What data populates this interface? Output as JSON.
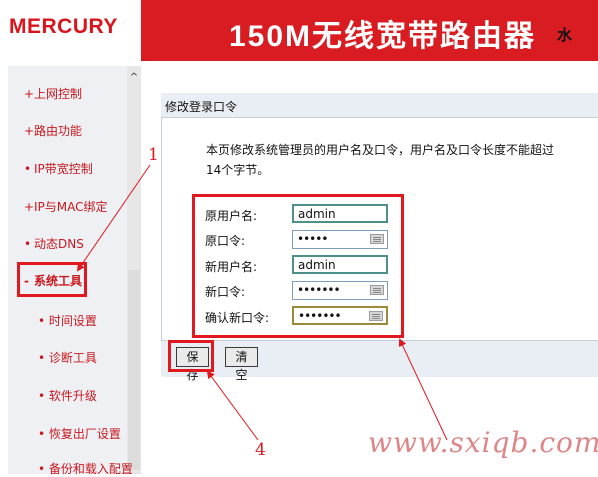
{
  "header": {
    "logo": "MERCURY",
    "title": "150M无线宽带路由器",
    "title_tail": "水"
  },
  "sidebar": {
    "items": [
      {
        "label": "上网控制",
        "bullet": "+"
      },
      {
        "label": "路由功能",
        "bullet": "+"
      },
      {
        "label": "IP带宽控制",
        "bullet": "•"
      },
      {
        "label": "IP与MAC绑定",
        "bullet": "+"
      },
      {
        "label": "动态DNS",
        "bullet": "•"
      },
      {
        "label": "系统工具",
        "bullet": "-"
      }
    ],
    "subitems": [
      {
        "label": "时间设置"
      },
      {
        "label": "诊断工具"
      },
      {
        "label": "软件升级"
      },
      {
        "label": "恢复出厂设置"
      },
      {
        "label": "备份和载入配置"
      }
    ],
    "scroll_up": "^"
  },
  "panel": {
    "title": "修改登录口令",
    "description": "本页修改系统管理员的用户名及口令，用户名及口令长度不能超过14个字节。",
    "fields": [
      {
        "label": "原用户名:",
        "value": "admin",
        "type": "text"
      },
      {
        "label": "原口令:",
        "value": "•••••",
        "type": "password"
      },
      {
        "label": "新用户名:",
        "value": "admin",
        "type": "text"
      },
      {
        "label": "新口令:",
        "value": "•••••••",
        "type": "password"
      },
      {
        "label": "确认新口令:",
        "value": "•••••••",
        "type": "password"
      }
    ],
    "buttons": {
      "save": "保存",
      "clear": "清空"
    }
  },
  "annotations": {
    "one": "1",
    "four": "4"
  },
  "watermark": "www.sxiqb.com",
  "colors": {
    "brand_red": "#d81c22",
    "highlight_red": "#e01820",
    "menu_text": "#c8181f",
    "panel_bar": "#e9eef4"
  }
}
